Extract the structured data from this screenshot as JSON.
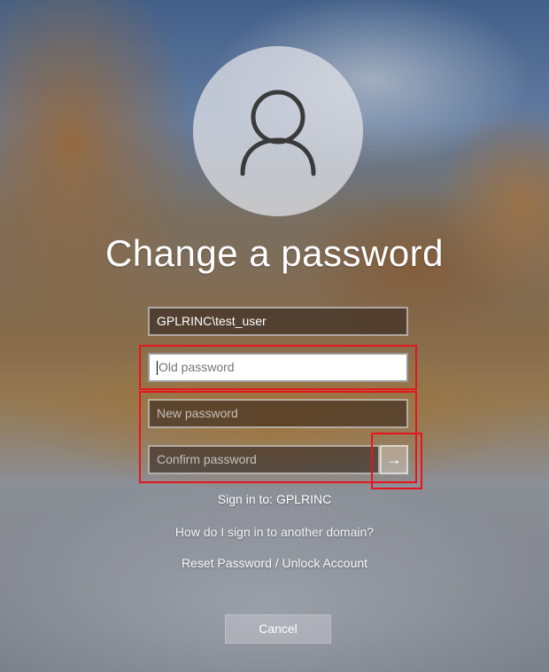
{
  "screen": {
    "title": "Change a password"
  },
  "fields": {
    "username_value": "GPLRINC\\test_user",
    "old_password_placeholder": "Old password",
    "new_password_placeholder": "New password",
    "confirm_password_placeholder": "Confirm password"
  },
  "buttons": {
    "submit_icon": "→",
    "cancel_label": "Cancel"
  },
  "links": {
    "sign_in_to": "Sign in to: GPLRINC",
    "other_domain": "How do I sign in to another domain?",
    "reset_unlock": "Reset Password / Unlock Account"
  },
  "icons": {
    "avatar": "user-silhouette-icon",
    "submit": "arrow-right-icon"
  },
  "colors": {
    "highlight": "#e8141c",
    "text": "#ffffff"
  }
}
